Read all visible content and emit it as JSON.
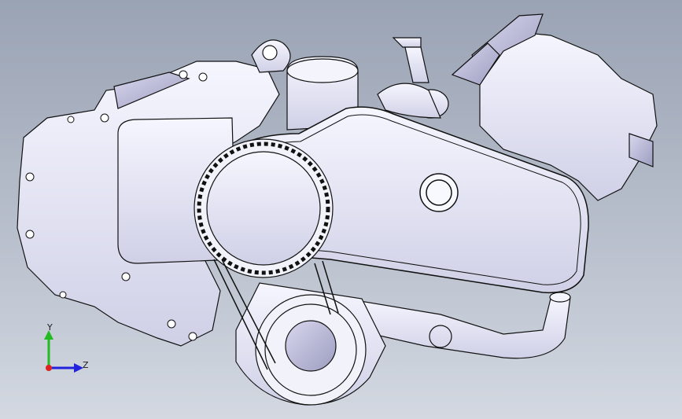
{
  "viewport": {
    "background_top": "#9aa3b4",
    "background_bottom": "#d3d8e1",
    "part_fill": "#eeeef8",
    "part_shade": "#c8c8de",
    "edge_color": "#111111"
  },
  "triad": {
    "y_label": "Y",
    "z_label": "Z",
    "y_color": "#22bb22",
    "z_color": "#2222dd",
    "x_color": "#dd2222"
  }
}
